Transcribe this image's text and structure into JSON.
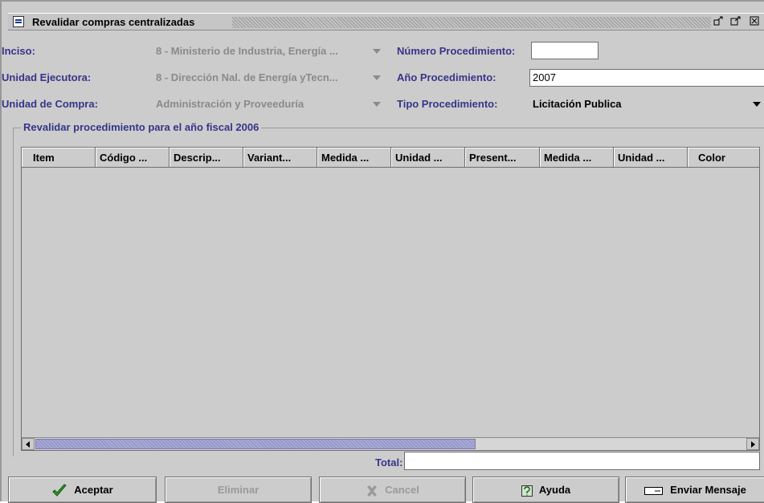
{
  "window": {
    "title": "Revalidar compras centralizadas",
    "controls": [
      "restore-icon",
      "maximize-icon",
      "close-icon"
    ]
  },
  "form": {
    "inciso_label": "Inciso:",
    "inciso_value": "8 - Ministerio de Industria, Energía ...",
    "unidad_ejecutora_label": "Unidad Ejecutora:",
    "unidad_ejecutora_value": "8 - Dirección Nal. de Energía yTecn...",
    "unidad_compra_label": "Unidad de Compra:",
    "unidad_compra_value": "Administración y Proveeduría",
    "numero_proc_label": "Número Procedimiento:",
    "numero_proc_value": "",
    "anio_proc_label": "Año Procedimiento:",
    "anio_proc_value": "2007",
    "tipo_proc_label": "Tipo Procedimiento:",
    "tipo_proc_value": "Licitación Publica"
  },
  "group": {
    "title": "Revalidar procedimiento para el año fiscal 2006"
  },
  "table": {
    "columns": [
      "Item",
      "Código ...",
      "Descrip...",
      "Variant...",
      "Medida ...",
      "Unidad ...",
      "Present...",
      "Medida ...",
      "Unidad ...",
      "Color"
    ],
    "rows": []
  },
  "total": {
    "label": "Total:",
    "value": ""
  },
  "buttons": {
    "aceptar": "Aceptar",
    "eliminar": "Eliminar",
    "cancel": "Cancel",
    "ayuda": "Ayuda",
    "enviar": "Enviar Mensaje"
  },
  "colors": {
    "label": "#35358a",
    "panel": "#cccccc",
    "scroll_thumb": "#a9a9d6",
    "check": "#2e9a2e"
  }
}
